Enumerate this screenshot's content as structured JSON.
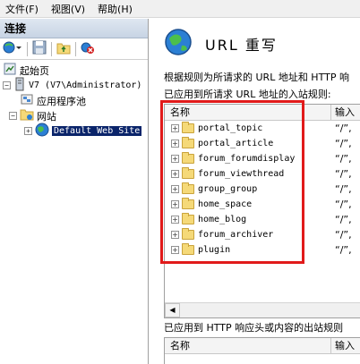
{
  "menu": {
    "file": "文件(F)",
    "view": "视图(V)",
    "help": "帮助(H)"
  },
  "left_panel": {
    "header": "连接",
    "tree": {
      "start_page": "起始页",
      "server": "V7 (V7\\Administrator)",
      "app_pools": "应用程序池",
      "sites": "网站",
      "default_site": "Default Web Site"
    }
  },
  "right_panel": {
    "title": "URL 重写",
    "description_line1": "根据规则为所请求的 URL 地址和 HTTP 响",
    "description_line2": "已应用到所请求 URL 地址的入站规则:",
    "inbound": {
      "columns": [
        "名称",
        "输入"
      ],
      "rules": [
        {
          "name": "portal_topic",
          "input": "“/”,"
        },
        {
          "name": "portal_article",
          "input": "“/”,"
        },
        {
          "name": "forum_forumdisplay",
          "input": "“/”,"
        },
        {
          "name": "forum_viewthread",
          "input": "“/”,"
        },
        {
          "name": "group_group",
          "input": "“/”,"
        },
        {
          "name": "home_space",
          "input": "“/”,"
        },
        {
          "name": "home_blog",
          "input": "“/”,"
        },
        {
          "name": "forum_archiver",
          "input": "“/”,"
        },
        {
          "name": "plugin",
          "input": "“/”,"
        }
      ]
    },
    "outbound_description": "已应用到 HTTP 响应头或内容的出站规则",
    "outbound": {
      "columns": [
        "名称",
        "输入"
      ]
    }
  },
  "colors": {
    "highlight_border": "#e11a1a",
    "selection": "#0a246a"
  }
}
